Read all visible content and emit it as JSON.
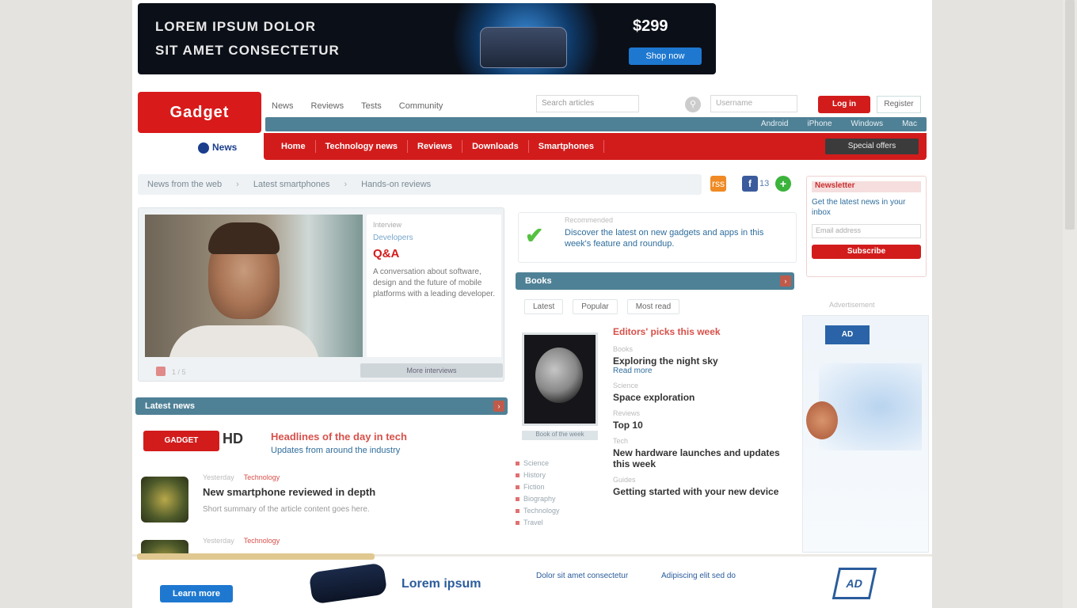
{
  "top_ad": {
    "line1": "LOREM IPSUM DOLOR",
    "line2": "SIT AMET CONSECTETUR",
    "price": "$299",
    "cta": "Shop now"
  },
  "header": {
    "logo": "Gadget",
    "logo_sub": "News",
    "topnav": [
      "News",
      "Reviews",
      "Tests",
      "Community"
    ],
    "search_placeholder": "Search articles",
    "login_placeholder": "Username",
    "login_label": "Log in",
    "register_label": "Register"
  },
  "subnav": [
    "Android",
    "iPhone",
    "Windows",
    "Mac"
  ],
  "mainnav": {
    "items": [
      "Home",
      "Technology news",
      "Reviews",
      "Downloads",
      "Smartphones"
    ],
    "special": "Special offers"
  },
  "breadcrumb": [
    "News from the web",
    "Latest smartphones",
    "Hands-on reviews"
  ],
  "share": {
    "rss": "rss",
    "fb": "f",
    "count": "13",
    "plus": "+"
  },
  "feature": {
    "kicker": "Interview",
    "tag": "Developers",
    "headline": "Q&A",
    "desc": "A conversation about software, design and the future of mobile platforms with a leading developer.",
    "dot_label": "1 / 5",
    "more": "More interviews"
  },
  "callout": {
    "kick": "Recommended",
    "text": "Discover the latest on new gadgets and apps in this week's feature and roundup."
  },
  "sections": {
    "middle": "Books",
    "left": "Latest news"
  },
  "tabs": [
    "Latest",
    "Popular",
    "Most read"
  ],
  "book_caption": "Book of the week",
  "mid_links": [
    "Science",
    "History",
    "Fiction",
    "Biography",
    "Technology",
    "Travel"
  ],
  "news_list": {
    "red_head": "Editors' picks this week",
    "items": [
      {
        "small": "Books",
        "title": "Exploring the night sky",
        "sub": "Read more"
      },
      {
        "small": "Science",
        "title": "Space exploration",
        "sub": ""
      },
      {
        "small": "Reviews",
        "title": "Top 10",
        "sub": ""
      },
      {
        "small": "Tech",
        "title": "New hardware launches and updates this week",
        "sub": ""
      },
      {
        "small": "Guides",
        "title": "Getting started with your new device",
        "sub": ""
      }
    ]
  },
  "lead": {
    "mini_logo": "GADGET",
    "mini_num": "HD",
    "title": "Headlines of the day in tech",
    "sub": "Updates from around the industry"
  },
  "articles": [
    {
      "meta": "Yesterday",
      "cat": "Technology",
      "title": "New smartphone reviewed in depth",
      "sub": "Short summary of the article content goes here."
    },
    {
      "meta": "Yesterday",
      "cat": "Technology",
      "title": "",
      "sub": ""
    }
  ],
  "promo": {
    "head": "Newsletter",
    "sub": "Get the latest news in your inbox",
    "field": "Email address",
    "btn": "Subscribe"
  },
  "ad_label": "Advertisement",
  "side_ad": {
    "logo": "AD"
  },
  "bottom_ad": {
    "cta": "Learn more",
    "tag": "Lorem ipsum",
    "col1": "Dolor sit amet consectetur",
    "col2": "Adipiscing elit sed do",
    "brand": "AD"
  }
}
